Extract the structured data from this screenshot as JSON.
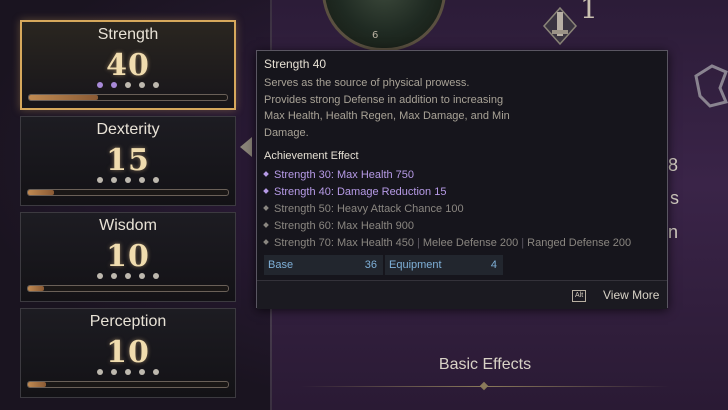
{
  "medallion_number": "6",
  "rank_number": "1",
  "right_partial": [
    "8",
    "s",
    "n"
  ],
  "stats": [
    {
      "name": "Strength",
      "value": "40",
      "selected": true,
      "progress": 0.35,
      "dots_on": 2
    },
    {
      "name": "Dexterity",
      "value": "15",
      "selected": false,
      "progress": 0.13,
      "dots_on": 0
    },
    {
      "name": "Wisdom",
      "value": "10",
      "selected": false,
      "progress": 0.08,
      "dots_on": 0
    },
    {
      "name": "Perception",
      "value": "10",
      "selected": false,
      "progress": 0.09,
      "dots_on": 0
    }
  ],
  "tooltip": {
    "title": "Strength 40",
    "description": "Serves as the source of physical prowess. Provides strong Defense in addition to increasing Max Health, Health Regen, Max Damage, and Min Damage.",
    "achievement_title": "Achievement Effect",
    "achievements": [
      {
        "text": "Strength 30: Max Health 750",
        "active": true
      },
      {
        "text": "Strength 40: Damage Reduction 15",
        "active": true
      },
      {
        "text": "Strength 50: Heavy Attack Chance 100",
        "active": false
      },
      {
        "text": "Strength 60: Max Health 900",
        "active": false
      },
      {
        "text": "Strength 70: Max Health 450",
        "extra": [
          "Melee Defense 200",
          "Ranged Defense 200"
        ],
        "active": false
      }
    ],
    "base_label": "Base",
    "base_value": "36",
    "equipment_label": "Equipment",
    "equipment_value": "4",
    "alt_key": "Alt",
    "view_more": "View More"
  },
  "basic_effects": "Basic Effects",
  "colors": {
    "accent_gold": "#d6a85c",
    "achievement_active": "#b69ae6",
    "stat_label_blue": "#7fb0d8"
  }
}
